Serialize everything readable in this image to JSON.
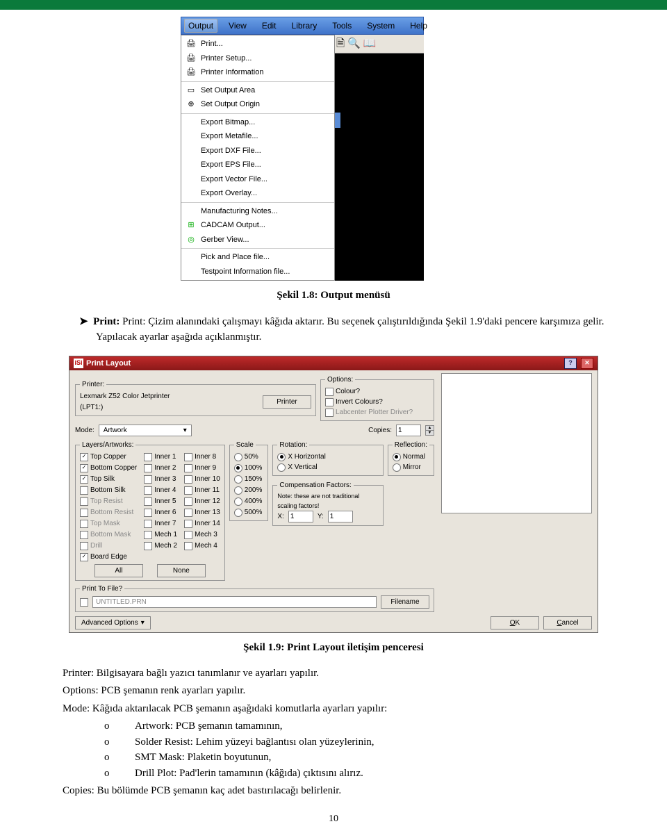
{
  "menubar": {
    "items": [
      "Output",
      "View",
      "Edit",
      "Library",
      "Tools",
      "System",
      "Help"
    ]
  },
  "dropdown": {
    "groups": [
      [
        "Print...",
        "Printer Setup...",
        "Printer Information"
      ],
      [
        "Set Output Area",
        "Set Output Origin"
      ],
      [
        "Export Bitmap...",
        "Export Metafile...",
        "Export DXF File...",
        "Export EPS File...",
        "Export Vector File...",
        "Export Overlay..."
      ],
      [
        "Manufacturing Notes...",
        "CADCAM Output...",
        "Gerber View..."
      ],
      [
        "Pick and Place file...",
        "Testpoint Information file..."
      ]
    ]
  },
  "caption1": "Şekil 1.8: Output menüsü",
  "para1": "Print: Çizim alanındaki çalışmayı kâğıda aktarır. Bu seçenek çalıştırıldığında Şekil 1.9'daki pencere karşımıza gelir. Yapılacak ayarlar aşağıda açıklanmıştır.",
  "bullet": "➤",
  "pl": {
    "title": "Print Layout",
    "printer_legend": "Printer:",
    "printer_name": "Lexmark Z52 Color Jetprinter",
    "printer_port": "(LPT1:)",
    "printer_btn": "Printer",
    "options_legend": "Options:",
    "opt1": "Colour?",
    "opt2": "Invert Colours?",
    "opt3": "Labcenter Plotter Driver?",
    "mode_label": "Mode:",
    "mode_value": "Artwork",
    "copies_label": "Copies:",
    "copies_value": "1",
    "layers_legend": "Layers/Artworks:",
    "layers_col1": [
      [
        "Top Copper",
        1
      ],
      [
        "Bottom Copper",
        1
      ],
      [
        "Top Silk",
        1
      ],
      [
        "Bottom Silk",
        0
      ],
      [
        "Top Resist",
        0,
        "dim"
      ],
      [
        "Bottom Resist",
        0,
        "dim"
      ],
      [
        "Top Mask",
        0,
        "dim"
      ],
      [
        "Bottom Mask",
        0,
        "dim"
      ],
      [
        "Drill",
        0,
        "dim"
      ],
      [
        "Board Edge",
        1
      ]
    ],
    "layers_col2": [
      [
        "Inner 1",
        0
      ],
      [
        "Inner 2",
        0
      ],
      [
        "Inner 3",
        0
      ],
      [
        "Inner 4",
        0
      ],
      [
        "Inner 5",
        0
      ],
      [
        "Inner 6",
        0
      ],
      [
        "Inner 7",
        0
      ],
      [
        "Mech 1",
        0
      ],
      [
        "Mech 2",
        0
      ]
    ],
    "layers_col3": [
      [
        "Inner 8",
        0
      ],
      [
        "Inner 9",
        0
      ],
      [
        "Inner 10",
        0
      ],
      [
        "Inner 11",
        0
      ],
      [
        "Inner 12",
        0
      ],
      [
        "Inner 13",
        0
      ],
      [
        "Inner 14",
        0
      ],
      [
        "Mech 3",
        0
      ],
      [
        "Mech 4",
        0
      ]
    ],
    "all_btn": "All",
    "none_btn": "None",
    "scale_legend": "Scale",
    "scales": [
      "50%",
      "100%",
      "150%",
      "200%",
      "400%",
      "500%"
    ],
    "scale_sel": "100%",
    "rot_legend": "Rotation:",
    "rot1": "X Horizontal",
    "rot2": "X Vertical",
    "rot_sel": "X Horizontal",
    "refl_legend": "Reflection:",
    "refl1": "Normal",
    "refl2": "Mirror",
    "refl_sel": "Normal",
    "comp_legend": "Compensation Factors:",
    "comp_note": "Note: these are not traditional scaling factors!",
    "compx": "X:",
    "compy": "Y:",
    "compxv": "1",
    "compyv": "1",
    "ptf_legend": "Print To File?",
    "ptf_file": "UNTITLED.PRN",
    "ptf_btn": "Filename",
    "adv": "Advanced Options",
    "ok": "OK",
    "cancel": "Cancel"
  },
  "caption2": "Şekil 1.9: Print Layout iletişim penceresi",
  "desc": {
    "l1": "Printer: Bilgisayara bağlı yazıcı tanımlanır ve ayarları yapılır.",
    "l2": "Options: PCB şemanın renk ayarları yapılır.",
    "l3": "Mode: Kâğıda aktarılacak PCB şemanın aşağıdaki komutlarla ayarları yapılır:",
    "o1": "Artwork: PCB şemanın tamamının,",
    "o2": "Solder Resist: Lehim yüzeyi bağlantısı olan yüzeylerinin,",
    "o3": "SMT Mask: Plaketin boyutunun,",
    "o4": "Drill Plot: Pad'lerin tamamının (kâğıda) çıktısını alırız.",
    "l4": "Copies: Bu bölümde PCB şemanın kaç adet bastırılacağı belirlenir."
  },
  "ob": "o",
  "pagenum": "10"
}
